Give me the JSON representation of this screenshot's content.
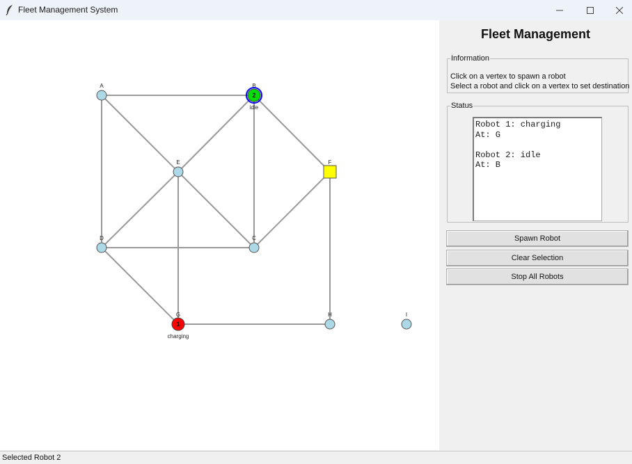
{
  "window": {
    "title": "Fleet Management System"
  },
  "panel": {
    "title": "Fleet Management",
    "information": {
      "legend": "Information",
      "line1": "Click on a vertex to spawn a robot",
      "line2": "Select a robot and click on a vertex to set destination"
    },
    "status": {
      "legend": "Status",
      "text": "Robot 1: charging\nAt: G\n\nRobot 2: idle\nAt: B"
    },
    "buttons": {
      "spawn": "Spawn Robot",
      "clear": "Clear Selection",
      "stop": "Stop All Robots"
    }
  },
  "statusbar": {
    "text": "Selected Robot 2"
  },
  "colors": {
    "vertex_fill": "#add8e6",
    "charging_station": "#ffff00",
    "edge": "#999999",
    "robot_charging": "#ff0000",
    "robot_idle": "#00dd00",
    "selection_ring": "#0000ff"
  },
  "graph": {
    "vertices": [
      {
        "id": "A",
        "label": "A",
        "kind": "normal"
      },
      {
        "id": "B",
        "label": "B",
        "kind": "normal"
      },
      {
        "id": "C",
        "label": "C",
        "kind": "normal"
      },
      {
        "id": "D",
        "label": "D",
        "kind": "normal"
      },
      {
        "id": "E",
        "label": "E",
        "kind": "normal"
      },
      {
        "id": "F",
        "label": "F",
        "kind": "charger"
      },
      {
        "id": "G",
        "label": "G",
        "kind": "normal"
      },
      {
        "id": "H",
        "label": "H",
        "kind": "normal"
      },
      {
        "id": "I",
        "label": "I",
        "kind": "normal"
      }
    ],
    "edges": [
      [
        "A",
        "B"
      ],
      [
        "A",
        "D"
      ],
      [
        "A",
        "E"
      ],
      [
        "B",
        "E"
      ],
      [
        "B",
        "C"
      ],
      [
        "B",
        "F"
      ],
      [
        "E",
        "D"
      ],
      [
        "E",
        "C"
      ],
      [
        "E",
        "G"
      ],
      [
        "F",
        "C"
      ],
      [
        "F",
        "H"
      ],
      [
        "D",
        "C"
      ],
      [
        "D",
        "G"
      ],
      [
        "G",
        "H"
      ]
    ],
    "robots": [
      {
        "number": "1",
        "at": "G",
        "state": "charging",
        "selected": false
      },
      {
        "number": "2",
        "at": "B",
        "state": "idle",
        "selected": true
      }
    ]
  }
}
